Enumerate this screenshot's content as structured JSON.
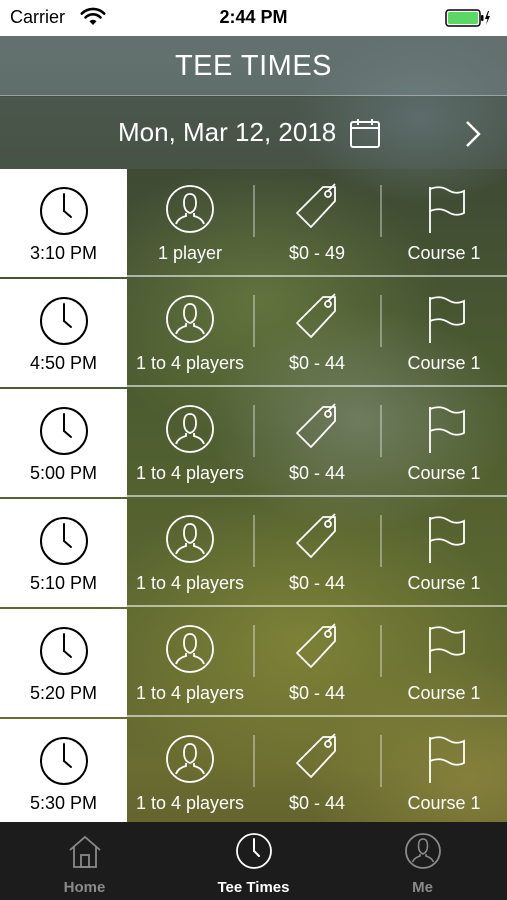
{
  "status_bar": {
    "carrier": "Carrier",
    "time": "2:44 PM",
    "battery_color": "#5bd763"
  },
  "header": {
    "title": "TEE TIMES"
  },
  "date_bar": {
    "date": "Mon, Mar 12, 2018",
    "calendar_icon": "calendar-icon",
    "next_icon": "chevron-right-icon"
  },
  "tee_times": [
    {
      "time": "3:10 PM",
      "players": "1 player",
      "price": "$0 - 49",
      "course": "Course 1"
    },
    {
      "time": "4:50 PM",
      "players": "1 to 4 players",
      "price": "$0 - 44",
      "course": "Course 1"
    },
    {
      "time": "5:00 PM",
      "players": "1 to 4 players",
      "price": "$0 - 44",
      "course": "Course 1"
    },
    {
      "time": "5:10 PM",
      "players": "1 to 4 players",
      "price": "$0 - 44",
      "course": "Course 1"
    },
    {
      "time": "5:20 PM",
      "players": "1 to 4 players",
      "price": "$0 - 44",
      "course": "Course 1"
    },
    {
      "time": "5:30 PM",
      "players": "1 to 4 players",
      "price": "$0 - 44",
      "course": "Course 1"
    }
  ],
  "tab_bar": {
    "tabs": [
      {
        "label": "Home",
        "icon": "home-icon",
        "active": false
      },
      {
        "label": "Tee Times",
        "icon": "clock-icon",
        "active": true
      },
      {
        "label": "Me",
        "icon": "person-icon",
        "active": false
      }
    ],
    "active_color": "#ffffff",
    "inactive_color": "#8a8a8a"
  }
}
